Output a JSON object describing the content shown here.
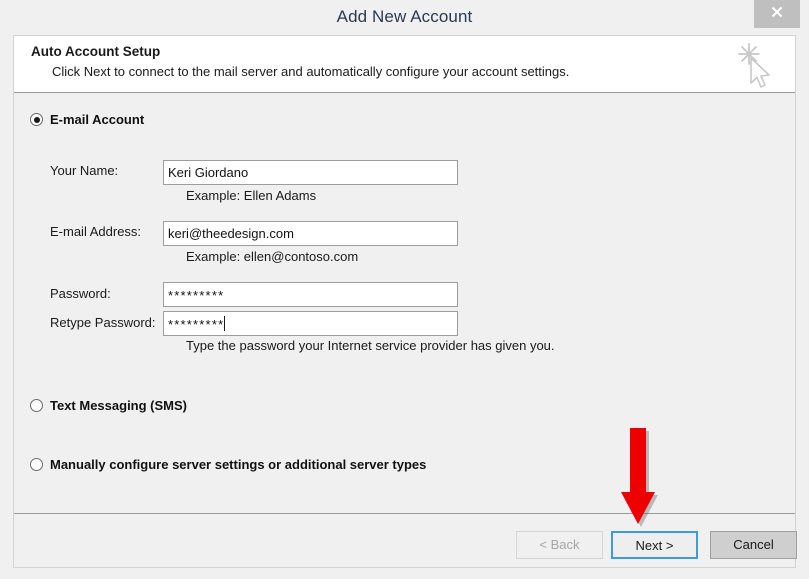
{
  "window": {
    "title": "Add New Account",
    "close_label": "×"
  },
  "header": {
    "title": "Auto Account Setup",
    "subtitle": "Click Next to connect to the mail server and automatically configure your account settings.",
    "icon": "cursor-sparkle-icon"
  },
  "options": [
    {
      "id": "email",
      "label": "E-mail Account",
      "selected": true
    },
    {
      "id": "sms",
      "label": "Text Messaging (SMS)",
      "selected": false
    },
    {
      "id": "manual",
      "label": "Manually configure server settings or additional server types",
      "selected": false
    }
  ],
  "form": {
    "name": {
      "label": "Your Name:",
      "value": "Keri Giordano",
      "placeholder": "",
      "hint": "Example: Ellen Adams"
    },
    "email": {
      "label": "E-mail Address:",
      "value": "keri@theedesign.com",
      "placeholder": "",
      "hint": "Example: ellen@contoso.com"
    },
    "password": {
      "label": "Password:",
      "value": "*********",
      "placeholder": ""
    },
    "retype_password": {
      "label": "Retype Password:",
      "value": "*********",
      "placeholder": ""
    },
    "password_hint": "Type the password your Internet service provider has given you."
  },
  "footer": {
    "back_label": "< Back",
    "next_label": "Next >",
    "cancel_label": "Cancel"
  },
  "annotation": {
    "type": "down-arrow",
    "color": "#ee0000",
    "points_to": "Next >"
  },
  "colors": {
    "dialog_background": "#f0f0f0",
    "header_panel": "#ffffff",
    "focus_border": "#3c9ade",
    "annotation_red": "#ee0000",
    "title_text": "#2b3a52"
  }
}
